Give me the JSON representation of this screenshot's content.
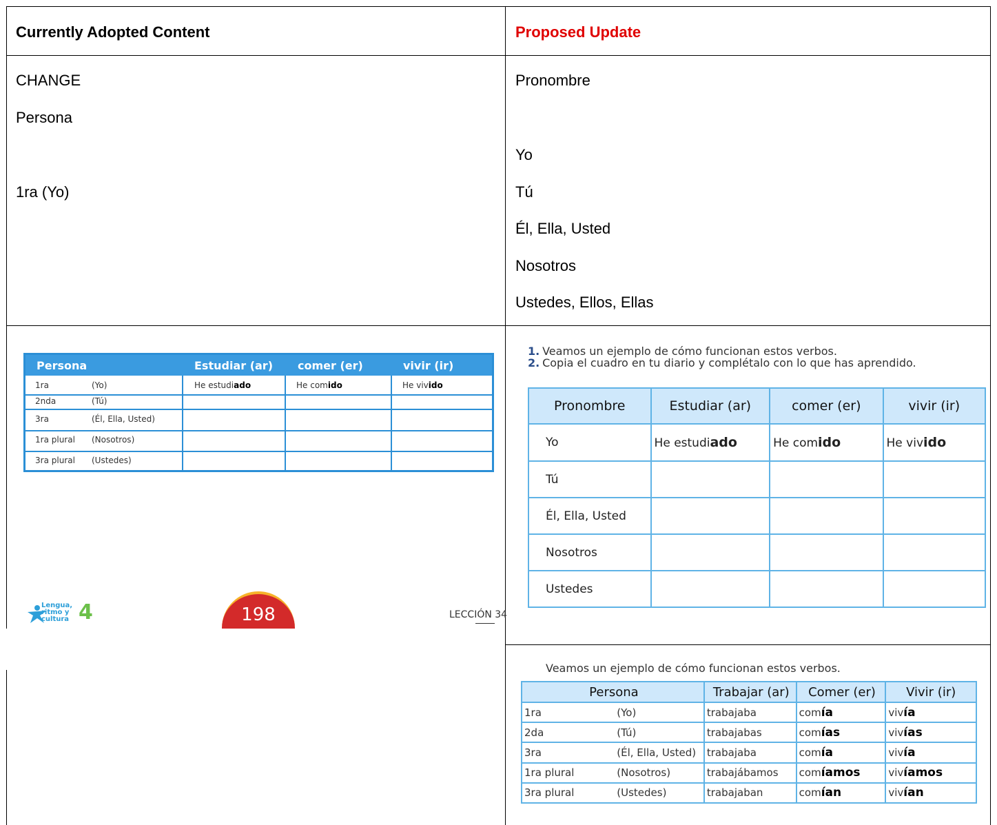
{
  "header": {
    "left": "Currently Adopted Content",
    "right": "Proposed Update"
  },
  "row1": {
    "left": [
      "CHANGE",
      "Persona",
      "1ra (Yo)"
    ],
    "right": [
      "Pronombre",
      "Yo",
      "Tú",
      "Él, Ella, Usted",
      "Nosotros",
      "Ustedes, Ellos, Ellas"
    ]
  },
  "adopted_table": {
    "headers": [
      "Persona",
      "Estudiar (ar)",
      "comer (er)",
      "vivir (ir)"
    ],
    "rows": [
      {
        "person": "1ra",
        "pronoun": "(Yo)",
        "stem1": "He estudi",
        "end1": "ado",
        "stem2": "He com",
        "end2": "ido",
        "stem3": "He viv",
        "end3": "ido"
      },
      {
        "person": "2nda",
        "pronoun": "(Tú)"
      },
      {
        "person": "3ra",
        "pronoun": "(Él, Ella, Usted)"
      },
      {
        "person": "1ra plural",
        "pronoun": "(Nosotros)"
      },
      {
        "person": "3ra plural",
        "pronoun": "(Ustedes)"
      }
    ],
    "logo": "Lengua, ritmo y cultura",
    "grade": "4",
    "page": "198",
    "lesson": "LECCIÓN 34",
    "brand_color": "#3a9be0"
  },
  "proposed_list": [
    {
      "n": "1.",
      "text": "Veamos un ejemplo de cómo funcionan estos verbos."
    },
    {
      "n": "2.",
      "text": "Copia el cuadro en tu diario y complétalo con lo que has aprendido."
    }
  ],
  "proposed_table": {
    "headers": [
      "Pronombre",
      "Estudiar (ar)",
      "comer (er)",
      "vivir (ir)"
    ],
    "rows": [
      {
        "pronoun": "Yo",
        "stem1": "He estudi",
        "end1": "ado",
        "stem2": "He com",
        "end2": "ido",
        "stem3": "He viv",
        "end3": "ido"
      },
      {
        "pronoun": "Tú"
      },
      {
        "pronoun": "Él, Ella, Usted"
      },
      {
        "pronoun": "Nosotros"
      },
      {
        "pronoun": "Ustedes"
      }
    ]
  },
  "imperfect": {
    "intro": "Veamos un ejemplo de cómo funcionan estos verbos.",
    "headers": [
      "Persona",
      "Trabajar (ar)",
      "Comer (er)",
      "Vivir (ir)"
    ],
    "rows": [
      {
        "person": "1ra",
        "pronoun": "(Yo)",
        "trabajar": "trabajaba",
        "c_stem": "com",
        "c_end": "ía",
        "v_stem": "viv",
        "v_end": "ía"
      },
      {
        "person": "2da",
        "pronoun": "(Tú)",
        "trabajar": "trabajabas",
        "c_stem": "com",
        "c_end": "ías",
        "v_stem": "viv",
        "v_end": "ías"
      },
      {
        "person": "3ra",
        "pronoun": "(Él, Ella, Usted)",
        "trabajar": "trabajaba",
        "c_stem": "com",
        "c_end": "ía",
        "v_stem": "viv",
        "v_end": "ía"
      },
      {
        "person": "1ra plural",
        "pronoun": "(Nosotros)",
        "trabajar": "trabajábamos",
        "c_stem": "com",
        "c_end": "íamos",
        "v_stem": "viv",
        "v_end": "íamos"
      },
      {
        "person": "3ra plural",
        "pronoun": "(Ustedes)",
        "trabajar": "trabajaban",
        "c_stem": "com",
        "c_end": "ían",
        "v_stem": "viv",
        "v_end": "ían"
      }
    ]
  }
}
